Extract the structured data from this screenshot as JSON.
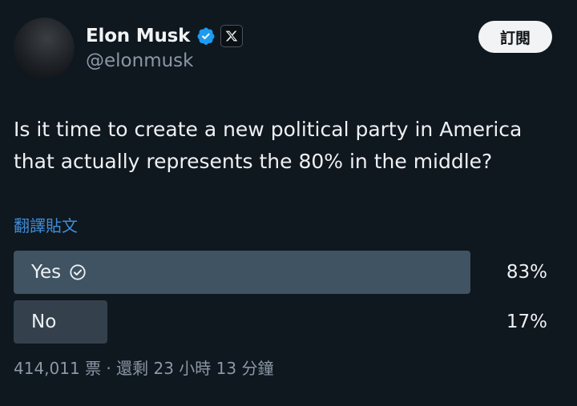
{
  "author": {
    "display_name": "Elon Musk",
    "handle": "@elonmusk",
    "verified_icon": "verified-badge-icon",
    "affiliation_icon": "x-logo-icon"
  },
  "subscribe_label": "訂閱",
  "tweet_text": "Is it time to create a new political party in America\nthat actually represents the 80% in the middle?",
  "translate_label": "翻譯貼文",
  "poll": {
    "options": [
      {
        "label": "Yes",
        "percent_text": "83%",
        "share": 0.83,
        "selected_icon": "check-circle-icon"
      },
      {
        "label": "No",
        "percent_text": "17%",
        "share": 0.17
      }
    ],
    "meta": "414,011 票 · 還剩 23 小時 13 分鐘"
  },
  "colors": {
    "background": "#0f171f",
    "winning_bar": "#3f5362",
    "losing_bar": "#34414d",
    "link": "#3f8ed8",
    "verified": "#1d9bf0"
  }
}
